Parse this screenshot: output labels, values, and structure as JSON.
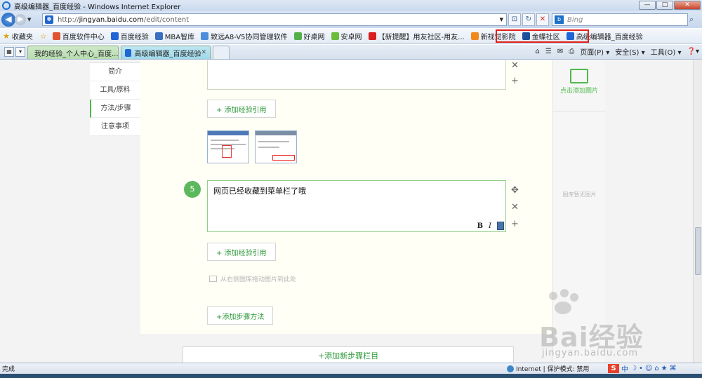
{
  "window": {
    "title": "高级编辑器_百度经验 - Windows Internet Explorer",
    "min": "—",
    "max": "□",
    "close": "✕"
  },
  "nav": {
    "back_icon": "◀",
    "forward_icon": "▶",
    "dropdown": "▼",
    "url_prefix": "http://",
    "url_domain": "jingyan.baidu.com",
    "url_path": "/edit/content",
    "compat_icon": "⊡",
    "refresh_icon": "↻",
    "stop_icon": "✕",
    "search_placeholder": "Bing",
    "search_icon": "⌕"
  },
  "favorites": {
    "label": "收藏夹",
    "items": [
      {
        "label": "百度软件中心",
        "color": "#e0542f"
      },
      {
        "label": "百度经验",
        "color": "#2064d6"
      },
      {
        "label": "MBA智库",
        "color": "#3a6fbf"
      },
      {
        "label": "致远A8-V5协同管理软件",
        "color": "#4d8ed8"
      },
      {
        "label": "好桌网",
        "color": "#55b04a"
      },
      {
        "label": "安卓网",
        "color": "#6bbd3c"
      },
      {
        "label": "【新提醒】用友社区-用友...",
        "color": "#d81e1e"
      },
      {
        "label": "新视觉影院",
        "color": "#f18a1d"
      },
      {
        "label": "金蝶社区",
        "color": "#1d4f9a"
      },
      {
        "label": "高级编辑器_百度经验",
        "color": "#2064d6"
      }
    ]
  },
  "tabs": [
    {
      "label": "我的经验_个人中心_百度...",
      "close": ""
    },
    {
      "label": "高级编辑器_百度经验",
      "close": "✕"
    }
  ],
  "commands": {
    "home": "⌂",
    "feeds": "☰",
    "mail": "✉",
    "print": "⎙",
    "page": "页面(P) ▾",
    "safety": "安全(S) ▾",
    "tools": "工具(O) ▾",
    "help": "❓▾"
  },
  "leftnav": [
    "简介",
    "工具/原料",
    "方法/步骤",
    "注意事项"
  ],
  "editor": {
    "add_ref": "+ 添加经验引用",
    "step_number": "5",
    "step_text": "网页已经收藏到菜单栏了哦",
    "bold": "B",
    "italic": "I",
    "drag_hint": "从右侧图库拖动图片到此处",
    "add_step": "+添加步骤方法",
    "add_section": "+添加新步骤栏目",
    "move_icon": "✥",
    "delete_icon": "✕",
    "add_icon": "+"
  },
  "right_panel": {
    "add_image": "点击添加图片",
    "empty": "图库暂无图片"
  },
  "watermark": {
    "text": "Bai经验",
    "url": "jingyan.baidu.com"
  },
  "status": {
    "left": "完成",
    "zone": "Internet | 保护模式: 禁用",
    "ime": [
      "中",
      "☽",
      "•",
      "☺",
      "⌂",
      "★",
      "⌘"
    ]
  }
}
